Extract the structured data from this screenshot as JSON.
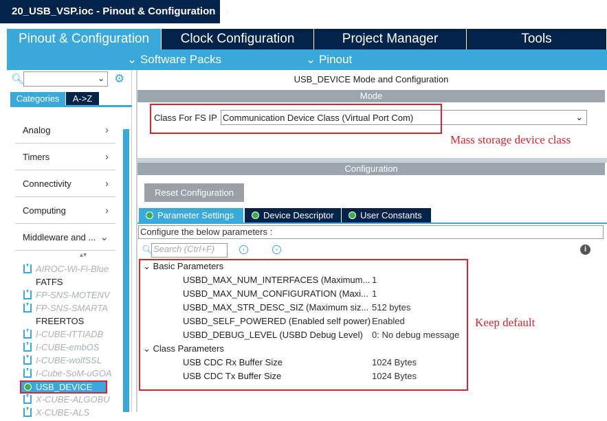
{
  "title": "20_USB_VSP.ioc - Pinout & Configuration",
  "tabs": [
    "Pinout & Configuration",
    "Clock Configuration",
    "Project Manager",
    "Tools"
  ],
  "subtabs": [
    "Software Packs",
    "Pinout"
  ],
  "sidebar": {
    "category_tabs": [
      "Categories",
      "A->Z"
    ],
    "categories": [
      "Analog",
      "Timers",
      "Connectivity",
      "Computing",
      "Middleware and ..."
    ],
    "middleware": [
      {
        "label": "AIROC-Wi-Fi-Blue",
        "dim": true
      },
      {
        "label": "FATFS",
        "dim": false
      },
      {
        "label": "FP-SNS-MOTENV",
        "dim": true
      },
      {
        "label": "FP-SNS-SMARTA",
        "dim": true
      },
      {
        "label": "FREERTOS",
        "dim": false
      },
      {
        "label": "I-CUBE-ITTIADB",
        "dim": true
      },
      {
        "label": "I-CUBE-embOS",
        "dim": true
      },
      {
        "label": "I-CUBE-wolfSSL",
        "dim": true
      },
      {
        "label": "I-Cube-SoM-uGOA",
        "dim": true
      },
      {
        "label": "USB_DEVICE",
        "selected": true
      },
      {
        "label": "X-CUBE-ALGOBU",
        "dim": true
      },
      {
        "label": "X-CUBE-ALS",
        "dim": true
      }
    ]
  },
  "main": {
    "heading": "USB_DEVICE Mode and Configuration",
    "mode_label": "Mode",
    "class_label": "Class For FS IP",
    "class_value": "Communication Device Class (Virtual Port Com)",
    "config_label": "Configuration",
    "reset_button": "Reset Configuration",
    "param_tabs": [
      "Parameter Settings",
      "Device Descriptor",
      "User Constants"
    ],
    "configure_text": "Configure the below parameters :",
    "search_placeholder": "Search (Ctrl+F)",
    "groups": [
      {
        "name": "Basic Parameters",
        "params": [
          {
            "name": "USBD_MAX_NUM_INTERFACES (Maximum...",
            "value": "1"
          },
          {
            "name": "USBD_MAX_NUM_CONFIGURATION (Maxi...",
            "value": "1"
          },
          {
            "name": "USBD_MAX_STR_DESC_SIZ (Maximum siz...",
            "value": "512 bytes"
          },
          {
            "name": "USBD_SELF_POWERED (Enabled self power)",
            "value": "Enabled"
          },
          {
            "name": "USBD_DEBUG_LEVEL (USBD Debug Level)",
            "value": "0: No debug message"
          }
        ]
      },
      {
        "name": "Class Parameters",
        "params": [
          {
            "name": "USB CDC Rx Buffer Size",
            "value": "1024 Bytes"
          },
          {
            "name": "USB CDC Tx Buffer Size",
            "value": "1024 Bytes"
          }
        ]
      }
    ]
  },
  "annotations": {
    "mode_note": "Mass storage device class",
    "param_note": "Keep default"
  },
  "colors": {
    "navy": "#03234b",
    "accent": "#39a9dc",
    "highlight": "#e0202a"
  }
}
